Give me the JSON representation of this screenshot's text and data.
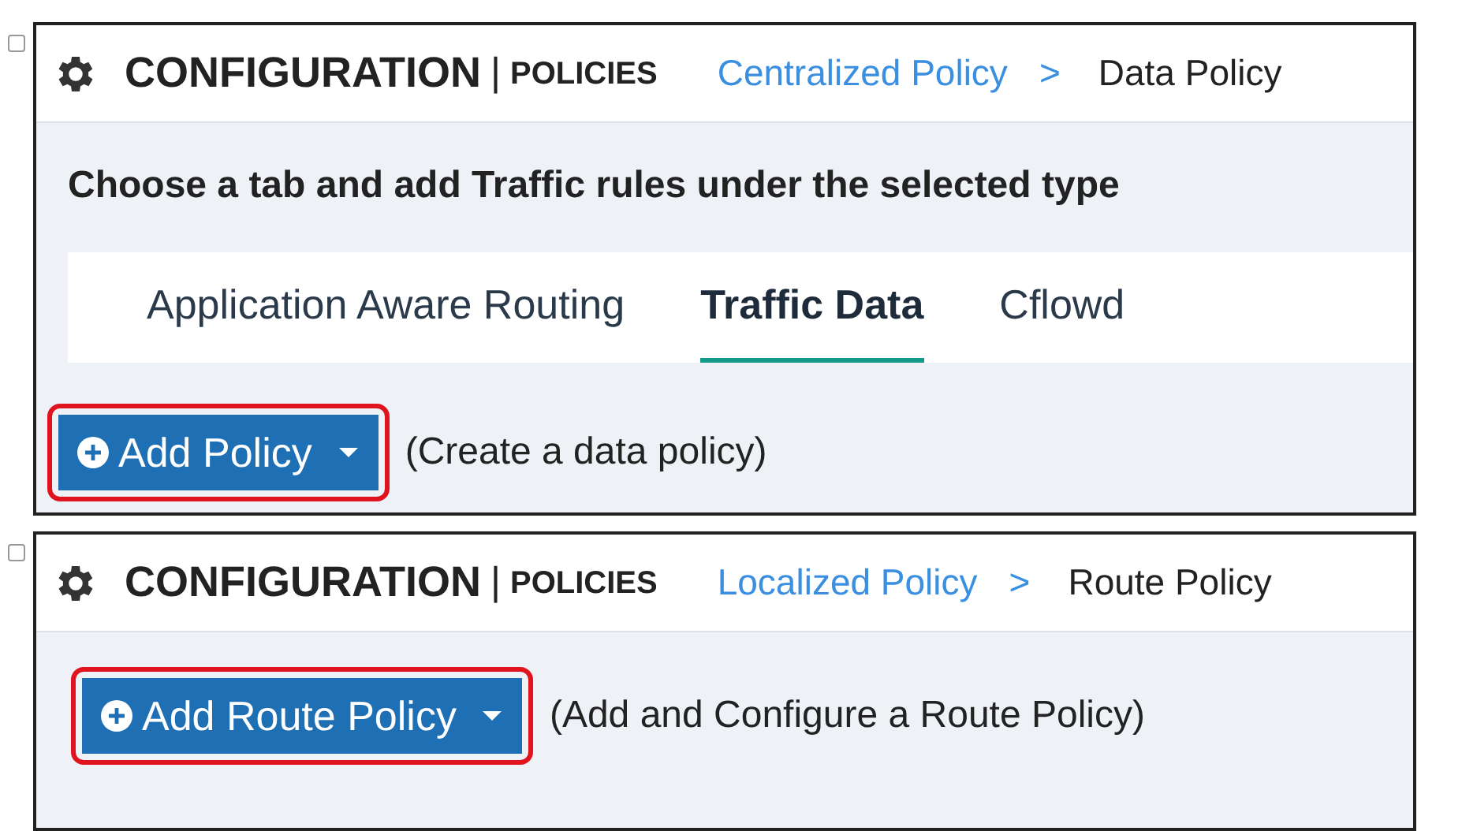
{
  "panels": [
    {
      "checkbox": {
        "checked": false
      },
      "title": "CONFIGURATION",
      "divider": "|",
      "section": "POLICIES",
      "breadcrumb": [
        {
          "label": "Centralized Policy",
          "kind": "link"
        },
        {
          "label": ">",
          "kind": "separator"
        },
        {
          "label": "Data Policy",
          "kind": "current"
        }
      ],
      "instruction": "Choose a tab and add Traffic rules under the selected type",
      "tabs": [
        {
          "label": "Application Aware Routing",
          "selected": false
        },
        {
          "label": "Traffic Data",
          "selected": true
        },
        {
          "label": "Cflowd",
          "selected": false
        }
      ],
      "action": {
        "label": "Add Policy",
        "highlighted": true
      },
      "hint": "(Create a data policy)"
    },
    {
      "checkbox": {
        "checked": false
      },
      "title": "CONFIGURATION",
      "divider": "|",
      "section": "POLICIES",
      "breadcrumb": [
        {
          "label": "Localized Policy",
          "kind": "link"
        },
        {
          "label": ">",
          "kind": "separator"
        },
        {
          "label": "Route Policy",
          "kind": "current"
        }
      ],
      "action": {
        "label": "Add Route Policy",
        "highlighted": true
      },
      "hint": "(Add and Configure a Route Policy)"
    }
  ]
}
